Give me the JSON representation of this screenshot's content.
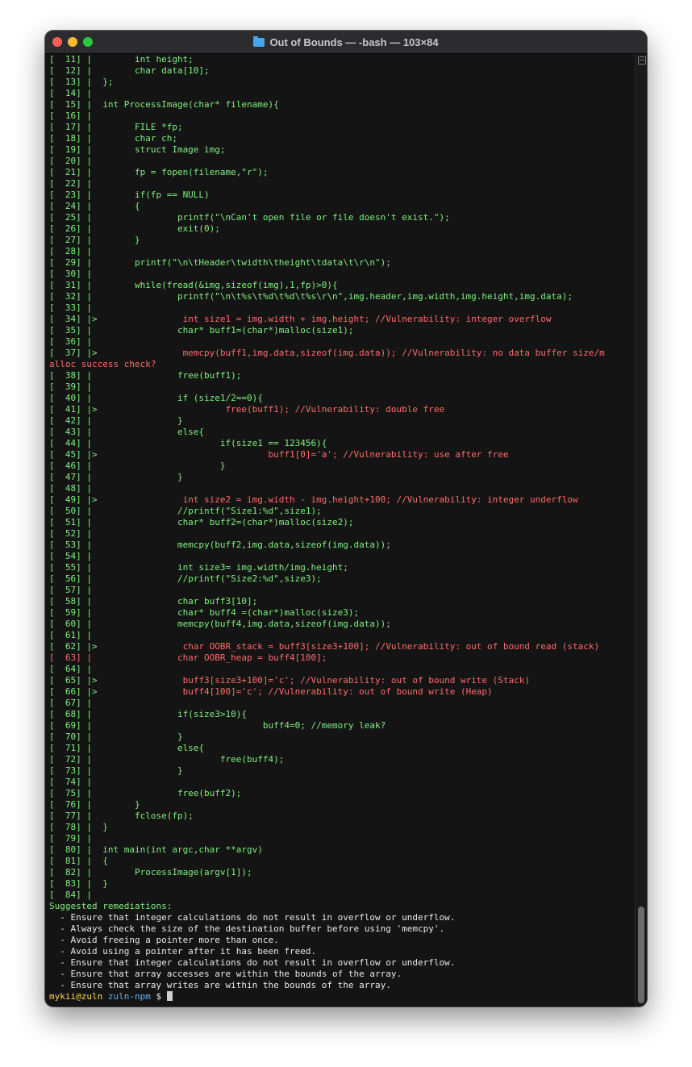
{
  "window": {
    "title": "Out of Bounds — -bash — 103×84"
  },
  "terminal": {
    "lines": [
      {
        "t": "[  11] |        int height;",
        "c": "g"
      },
      {
        "t": "[  12] |        char data[10];",
        "c": "g"
      },
      {
        "t": "[  13] |  };",
        "c": "g"
      },
      {
        "t": "[  14] |",
        "c": "g"
      },
      {
        "t": "[  15] |  int ProcessImage(char* filename){",
        "c": "g"
      },
      {
        "t": "[  16] |",
        "c": "g"
      },
      {
        "t": "[  17] |        FILE *fp;",
        "c": "g"
      },
      {
        "t": "[  18] |        char ch;",
        "c": "g"
      },
      {
        "t": "[  19] |        struct Image img;",
        "c": "g"
      },
      {
        "t": "[  20] |",
        "c": "g"
      },
      {
        "t": "[  21] |        fp = fopen(filename,\"r\");",
        "c": "g"
      },
      {
        "t": "[  22] |",
        "c": "g"
      },
      {
        "t": "[  23] |        if(fp == NULL)",
        "c": "g"
      },
      {
        "t": "[  24] |        {",
        "c": "g"
      },
      {
        "t": "[  25] |                printf(\"\\nCan't open file or file doesn't exist.\");",
        "c": "g"
      },
      {
        "t": "[  26] |                exit(0);",
        "c": "g"
      },
      {
        "t": "[  27] |        }",
        "c": "g"
      },
      {
        "t": "[  28] |",
        "c": "g"
      },
      {
        "t": "[  29] |        printf(\"\\n\\tHeader\\twidth\\theight\\tdata\\t\\r\\n\");",
        "c": "g"
      },
      {
        "t": "[  30] |",
        "c": "g"
      },
      {
        "t": "[  31] |        while(fread(&img,sizeof(img),1,fp)>0){",
        "c": "g"
      },
      {
        "t": "[  32] |                printf(\"\\n\\t%s\\t%d\\t%d\\t%s\\r\\n\",img.header,img.width,img.height,img.data);",
        "c": "g"
      },
      {
        "t": "[  33] |",
        "c": "g"
      },
      {
        "p": "[  34] |>",
        "t": "                int size1 = img.width + img.height; //Vulnerability: integer overflow",
        "c": "r"
      },
      {
        "t": "[  35] |                char* buff1=(char*)malloc(size1);",
        "c": "g"
      },
      {
        "t": "[  36] |",
        "c": "g"
      },
      {
        "p": "[  37] |>",
        "t": "                memcpy(buff1,img.data,sizeof(img.data)); //Vulnerability: no data buffer size/m",
        "c": "r"
      },
      {
        "t": "alloc success check?",
        "c": "r"
      },
      {
        "t": "[  38] |                free(buff1);",
        "c": "g"
      },
      {
        "t": "[  39] |",
        "c": "g"
      },
      {
        "t": "[  40] |                if (size1/2==0){",
        "c": "g"
      },
      {
        "p": "[  41] |>",
        "t": "                        free(buff1); //Vulnerability: double free",
        "c": "r"
      },
      {
        "t": "[  42] |                }",
        "c": "g"
      },
      {
        "t": "[  43] |                else{",
        "c": "g"
      },
      {
        "t": "[  44] |                        if(size1 == 123456){",
        "c": "g"
      },
      {
        "p": "[  45] |>",
        "t": "                                buff1[0]='a'; //Vulnerability: use after free",
        "c": "r"
      },
      {
        "t": "[  46] |                        }",
        "c": "g"
      },
      {
        "t": "[  47] |                }",
        "c": "g"
      },
      {
        "t": "[  48] |",
        "c": "g"
      },
      {
        "p": "[  49] |>",
        "t": "                int size2 = img.width - img.height+100; //Vulnerability: integer underflow",
        "c": "r"
      },
      {
        "t": "[  50] |                //printf(\"Size1:%d\",size1);",
        "c": "g"
      },
      {
        "t": "[  51] |                char* buff2=(char*)malloc(size2);",
        "c": "g"
      },
      {
        "t": "[  52] |",
        "c": "g"
      },
      {
        "t": "[  53] |                memcpy(buff2,img.data,sizeof(img.data));",
        "c": "g"
      },
      {
        "t": "[  54] |",
        "c": "g"
      },
      {
        "t": "[  55] |                int size3= img.width/img.height;",
        "c": "g"
      },
      {
        "t": "[  56] |                //printf(\"Size2:%d\",size3);",
        "c": "g"
      },
      {
        "t": "[  57] |",
        "c": "g"
      },
      {
        "t": "[  58] |                char buff3[10];",
        "c": "g"
      },
      {
        "t": "[  59] |                char* buff4 =(char*)malloc(size3);",
        "c": "g"
      },
      {
        "t": "[  60] |                memcpy(buff4,img.data,sizeof(img.data));",
        "c": "g"
      },
      {
        "t": "[  61] |",
        "c": "g"
      },
      {
        "p": "[  62] |>",
        "t": "                char OOBR_stack = buff3[size3+100]; //Vulnerability: out of bound read (stack)",
        "c": "r"
      },
      {
        "t": "[  63] |                char OOBR_heap = buff4[100];",
        "c": "r"
      },
      {
        "t": "[  64] |",
        "c": "g"
      },
      {
        "p": "[  65] |>",
        "t": "                buff3[size3+100]='c'; //Vulnerability: out of bound write (Stack)",
        "c": "r"
      },
      {
        "p": "[  66] |>",
        "t": "                buff4[100]='c'; //Vulnerability: out of bound write (Heap)",
        "c": "r"
      },
      {
        "t": "[  67] |",
        "c": "g"
      },
      {
        "t": "[  68] |                if(size3>10){",
        "c": "g"
      },
      {
        "t": "[  69] |                                buff4=0; //memory leak?",
        "c": "g"
      },
      {
        "t": "[  70] |                }",
        "c": "g"
      },
      {
        "t": "[  71] |                else{",
        "c": "g"
      },
      {
        "t": "[  72] |                        free(buff4);",
        "c": "g"
      },
      {
        "t": "[  73] |                }",
        "c": "g"
      },
      {
        "t": "[  74] |",
        "c": "g"
      },
      {
        "t": "[  75] |                free(buff2);",
        "c": "g"
      },
      {
        "t": "[  76] |        }",
        "c": "g"
      },
      {
        "t": "[  77] |        fclose(fp);",
        "c": "g"
      },
      {
        "t": "[  78] |  }",
        "c": "g"
      },
      {
        "t": "[  79] |",
        "c": "g"
      },
      {
        "t": "[  80] |  int main(int argc,char **argv)",
        "c": "g"
      },
      {
        "t": "[  81] |  {",
        "c": "g"
      },
      {
        "t": "[  82] |        ProcessImage(argv[1]);",
        "c": "g"
      },
      {
        "t": "[  83] |  }",
        "c": "g"
      },
      {
        "t": "[  84] |",
        "c": "g"
      }
    ],
    "remediations_heading": "Suggested remediations:",
    "remediations": [
      "  - Ensure that integer calculations do not result in overflow or underflow.",
      "  - Always check the size of the destination buffer before using 'memcpy'.",
      "  - Avoid freeing a pointer more than once.",
      "  - Avoid using a pointer after it has been freed.",
      "  - Ensure that integer calculations do not result in overflow or underflow.",
      "  - Ensure that array accesses are within the bounds of the array.",
      "  - Ensure that array writes are within the bounds of the array."
    ],
    "prompt": {
      "user": "mykii@zuln",
      "dir": "zuln-npm",
      "symbol": "$"
    }
  }
}
